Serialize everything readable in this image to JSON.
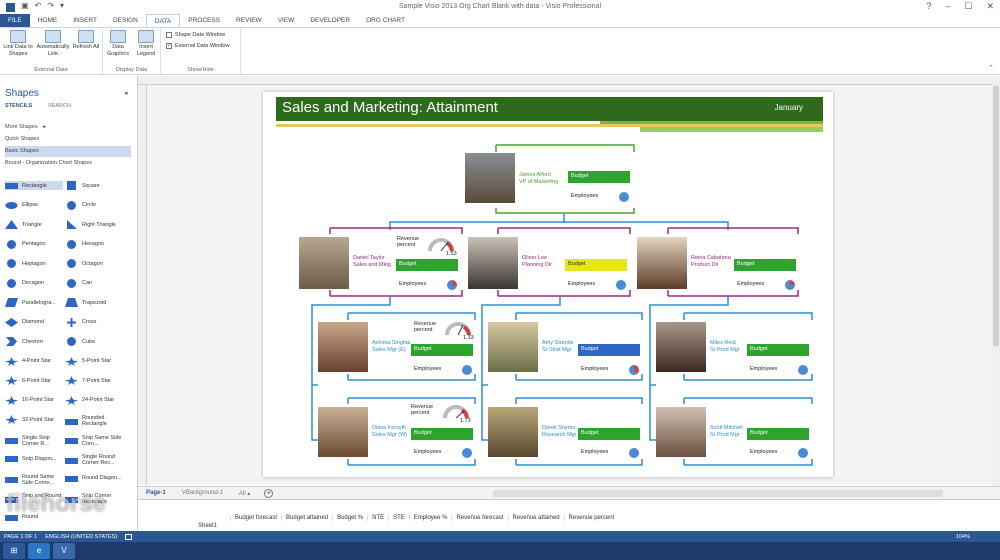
{
  "window": {
    "title": "Sample Visio 2013 Org Chart Blank with data - Visio Professional",
    "controls": [
      "?",
      "–",
      "☐",
      "✕"
    ]
  },
  "tabs": [
    "FILE",
    "HOME",
    "INSERT",
    "DESIGN",
    "DATA",
    "PROCESS",
    "REVIEW",
    "VIEW",
    "DEVELOPER",
    "ORG CHART"
  ],
  "active_tab": "DATA",
  "ribbon": {
    "link_data": "Link Data to Shapes",
    "auto_link": "Automatically Link",
    "refresh_all": "Refresh All",
    "external_data": "External Data",
    "data_graphics": "Data Graphics",
    "insert_legend": "Insert Legend",
    "display_data": "Display Data",
    "shape_data_window": "Shape Data Window",
    "external_data_window": "External Data Window",
    "show_hide": "Show/Hide"
  },
  "shapes_panel": {
    "title": "Shapes",
    "stencils": "STENCILS",
    "search": "SEARCH",
    "more_shapes": "More Shapes",
    "quick_shapes": "Quick Shapes",
    "basic_shapes": "Basic Shapes",
    "bound": "Bound - Organization Chart Shapes",
    "items": [
      [
        "Rectangle",
        "Square"
      ],
      [
        "Ellipse",
        "Circle"
      ],
      [
        "Triangle",
        "Right Triangle"
      ],
      [
        "Pentagon",
        "Hexagon"
      ],
      [
        "Heptagon",
        "Octagon"
      ],
      [
        "Decagon",
        "Can"
      ],
      [
        "Parallelogra...",
        "Trapezoid"
      ],
      [
        "Diamond",
        "Cross"
      ],
      [
        "Chevron",
        "Cube"
      ],
      [
        "4-Point Star",
        "5-Point Star"
      ],
      [
        "6-Point Star",
        "7-Point Star"
      ],
      [
        "16-Point Star",
        "24-Point Star"
      ],
      [
        "32-Point Star",
        "Rounded Rectangle"
      ],
      [
        "Single Snip Corner R...",
        "Snip Same Side Corn..."
      ],
      [
        "Snip Diagon...",
        "Single Round Corner Rec..."
      ],
      [
        "Round Same Side Corne...",
        "Round Diagon..."
      ],
      [
        "Snip and Round ...",
        "Snip Corner Rectangle"
      ],
      [
        "Round",
        ""
      ]
    ]
  },
  "chart": {
    "title": "Sales and Marketing:  Attainment",
    "month": "January",
    "colors": {
      "budget_green": "#2da52d",
      "budget_yellow": "#e6e61a",
      "budget_blue": "#2e66c4",
      "line_blue": "#2b8fd0",
      "line_purple": "#9b2a7b",
      "line_green": "#4aa32a"
    },
    "budget": "Budget",
    "employees": "Employees",
    "revenue_percent": "Revenue percent",
    "top": {
      "name": "James Alford",
      "role": "VP of Marketing"
    },
    "mid": [
      {
        "name": "Daniel Taylor",
        "role": "Sales and Mktg",
        "gauge": "1.53"
      },
      {
        "name": "Oliver Lee",
        "role": "Planning Dir"
      },
      {
        "name": "Reina Cabatana",
        "role": "Product Dir"
      }
    ],
    "low": [
      {
        "name": "Ashima Singhal",
        "role": "Sales Mgr (E)",
        "gauge": "1.33"
      },
      {
        "name": "Amy Strande",
        "role": "Sr Strat Mgr"
      },
      {
        "name": "Miles Reid",
        "role": "Sr Prod Mgr"
      },
      {
        "name": "Diane Forsyth",
        "role": "Sales Mgr (W)",
        "gauge": "1.73"
      },
      {
        "name": "Derek Snyder",
        "role": "Research Mgr"
      },
      {
        "name": "Scott Mitchell",
        "role": "Sr Prod Mgr"
      }
    ]
  },
  "pages": {
    "page1": "Page-1",
    "background": "VBackground-1",
    "all": "All"
  },
  "data_window": {
    "columns": [
      "Budget forecast",
      "Budget attained",
      "Budget %",
      "NTE",
      "STE",
      "Employee %",
      "Revenue forecast",
      "Revenue attained",
      "Revenue percent"
    ],
    "sheet": "Sheet1"
  },
  "status": {
    "page": "PAGE 1 OF 1",
    "language": "ENGLISH (UNITED STATES)",
    "zoom": "104%"
  },
  "watermark": "filehorse"
}
